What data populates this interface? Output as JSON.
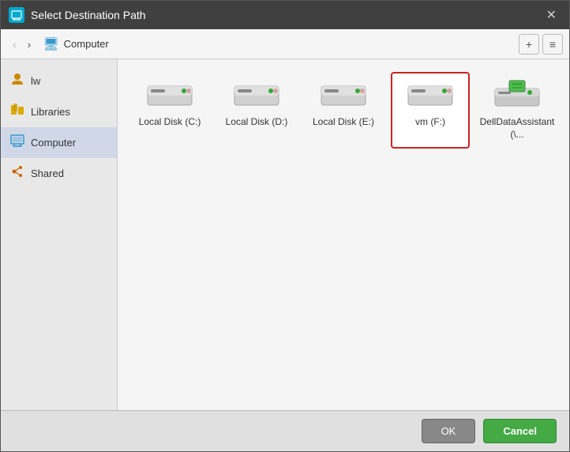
{
  "dialog": {
    "title": "Select Destination Path",
    "close_label": "✕"
  },
  "navbar": {
    "back_label": "‹",
    "forward_label": "›",
    "location_icon": "🖥",
    "location_text": "Computer",
    "new_folder_label": "+",
    "view_label": "≡"
  },
  "sidebar": {
    "items": [
      {
        "id": "lw",
        "label": "lw",
        "icon": "user",
        "active": false
      },
      {
        "id": "libraries",
        "label": "Libraries",
        "icon": "library",
        "active": false
      },
      {
        "id": "computer",
        "label": "Computer",
        "icon": "computer",
        "active": true
      },
      {
        "id": "shared",
        "label": "Shared",
        "icon": "shared",
        "active": false
      }
    ]
  },
  "files": [
    {
      "id": "c",
      "label": "Local Disk (C:)",
      "type": "hdd",
      "selected": false
    },
    {
      "id": "d",
      "label": "Local Disk (D:)",
      "type": "hdd",
      "selected": false
    },
    {
      "id": "e",
      "label": "Local Disk (E:)",
      "type": "hdd",
      "selected": false
    },
    {
      "id": "f",
      "label": "vm (F:)",
      "type": "hdd",
      "selected": true
    },
    {
      "id": "dell",
      "label": "DellDataAssistant (\\...",
      "type": "network",
      "selected": false
    }
  ],
  "footer": {
    "ok_label": "OK",
    "cancel_label": "Cancel"
  }
}
